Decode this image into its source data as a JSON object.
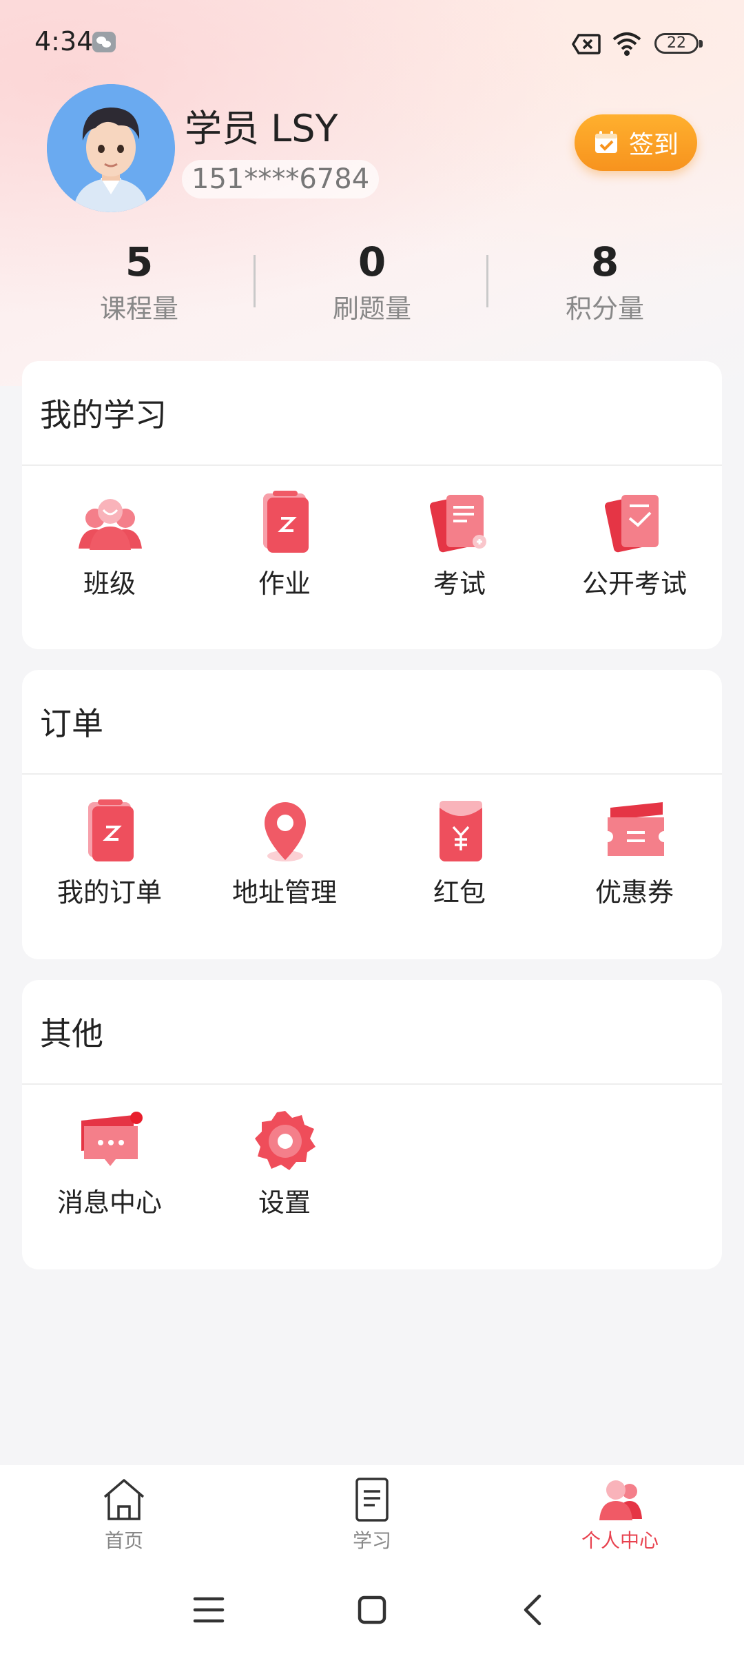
{
  "status_bar": {
    "time": "4:34",
    "battery": "22"
  },
  "profile": {
    "name": "学员 LSY",
    "phone": "151****6784",
    "signin_label": "签到"
  },
  "stats": [
    {
      "value": "5",
      "label": "课程量"
    },
    {
      "value": "0",
      "label": "刷题量"
    },
    {
      "value": "8",
      "label": "积分量"
    }
  ],
  "sections": {
    "study": {
      "title": "我的学习",
      "items": [
        "班级",
        "作业",
        "考试",
        "公开考试"
      ]
    },
    "orders": {
      "title": "订单",
      "items": [
        "我的订单",
        "地址管理",
        "红包",
        "优惠券"
      ]
    },
    "other": {
      "title": "其他",
      "items": [
        "消息中心",
        "设置"
      ]
    }
  },
  "tabs": [
    {
      "label": "首页",
      "active": false
    },
    {
      "label": "学习",
      "active": false
    },
    {
      "label": "个人中心",
      "active": true
    }
  ],
  "colors": {
    "accent": "#e8424f",
    "signin_orange": "#f7931e",
    "icon_red": "#f05a66"
  }
}
